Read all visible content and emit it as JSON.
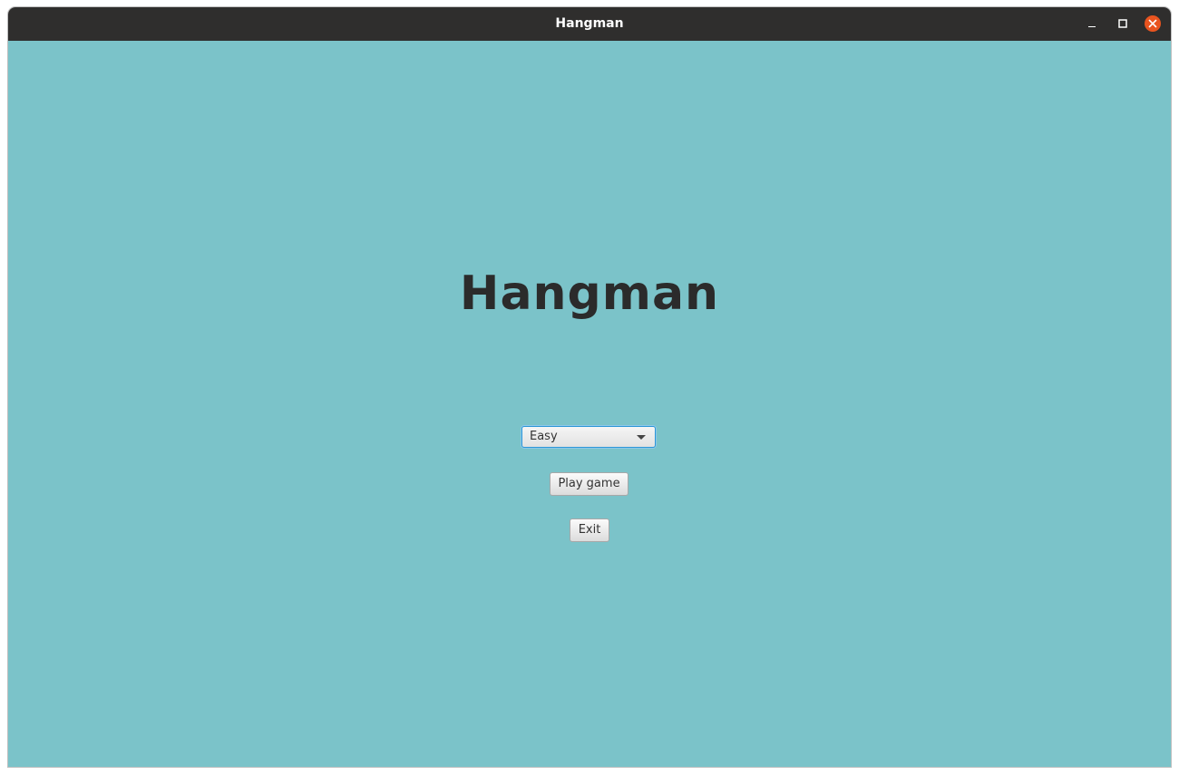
{
  "window": {
    "title": "Hangman",
    "controls": {
      "minimize": "minimize-icon",
      "maximize": "maximize-icon",
      "close": "close-icon"
    }
  },
  "main": {
    "heading": "Hangman",
    "difficulty": {
      "selected": "Easy"
    },
    "play_label": "Play game",
    "exit_label": "Exit"
  },
  "colors": {
    "titlebar": "#2f2e2d",
    "background": "#7bc3c9",
    "close_button": "#e9541f",
    "focus_ring": "#2d97d6",
    "heading_text": "#2b2b2b"
  }
}
